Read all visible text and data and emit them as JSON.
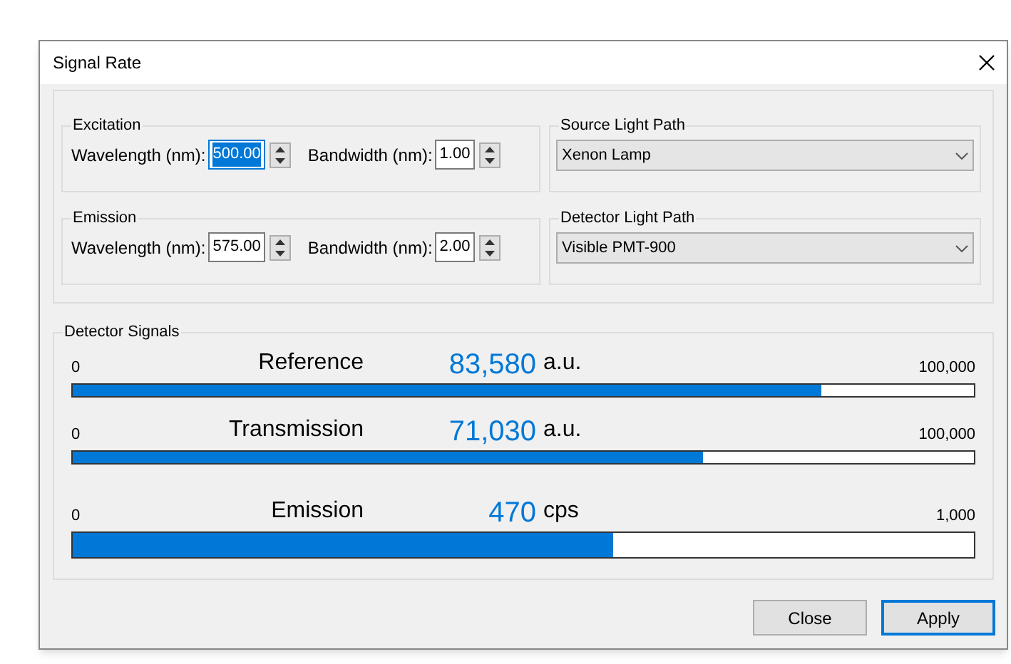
{
  "window": {
    "title": "Signal Rate"
  },
  "monochromators": [
    {
      "title": "Excitation",
      "wavelength": {
        "label": "Wavelength (nm):",
        "value": "500.00",
        "focused": true
      },
      "bandwidth": {
        "label": "Bandwidth (nm):",
        "value": "1.00",
        "focused": false
      }
    },
    {
      "title": "Emission",
      "wavelength": {
        "label": "Wavelength (nm):",
        "value": "575.00",
        "focused": false
      },
      "bandwidth": {
        "label": "Bandwidth (nm):",
        "value": "2.00",
        "focused": false
      }
    }
  ],
  "light_paths": [
    {
      "title": "Source Light Path",
      "value": "Xenon Lamp"
    },
    {
      "title": "Detector Light Path",
      "value": "Visible PMT-900"
    }
  ],
  "detector_signals": {
    "title": "Detector Signals",
    "signals": [
      {
        "min": "0",
        "name": "Reference",
        "value": "83,580",
        "unit": "a.u.",
        "max": "100,000",
        "level": 0.83,
        "kind": "thin"
      },
      {
        "min": "0",
        "name": "Transmission",
        "value": "71,030",
        "unit": "a.u.",
        "max": "100,000",
        "level": 0.7,
        "kind": "thin"
      },
      {
        "min": "0",
        "name": "Emission",
        "value": "470",
        "unit": "cps",
        "max": "1,000",
        "level": 0.6,
        "kind": "thick"
      }
    ]
  },
  "buttons": [
    {
      "label": "Close",
      "default": false
    },
    {
      "label": "Apply",
      "default": true
    }
  ]
}
